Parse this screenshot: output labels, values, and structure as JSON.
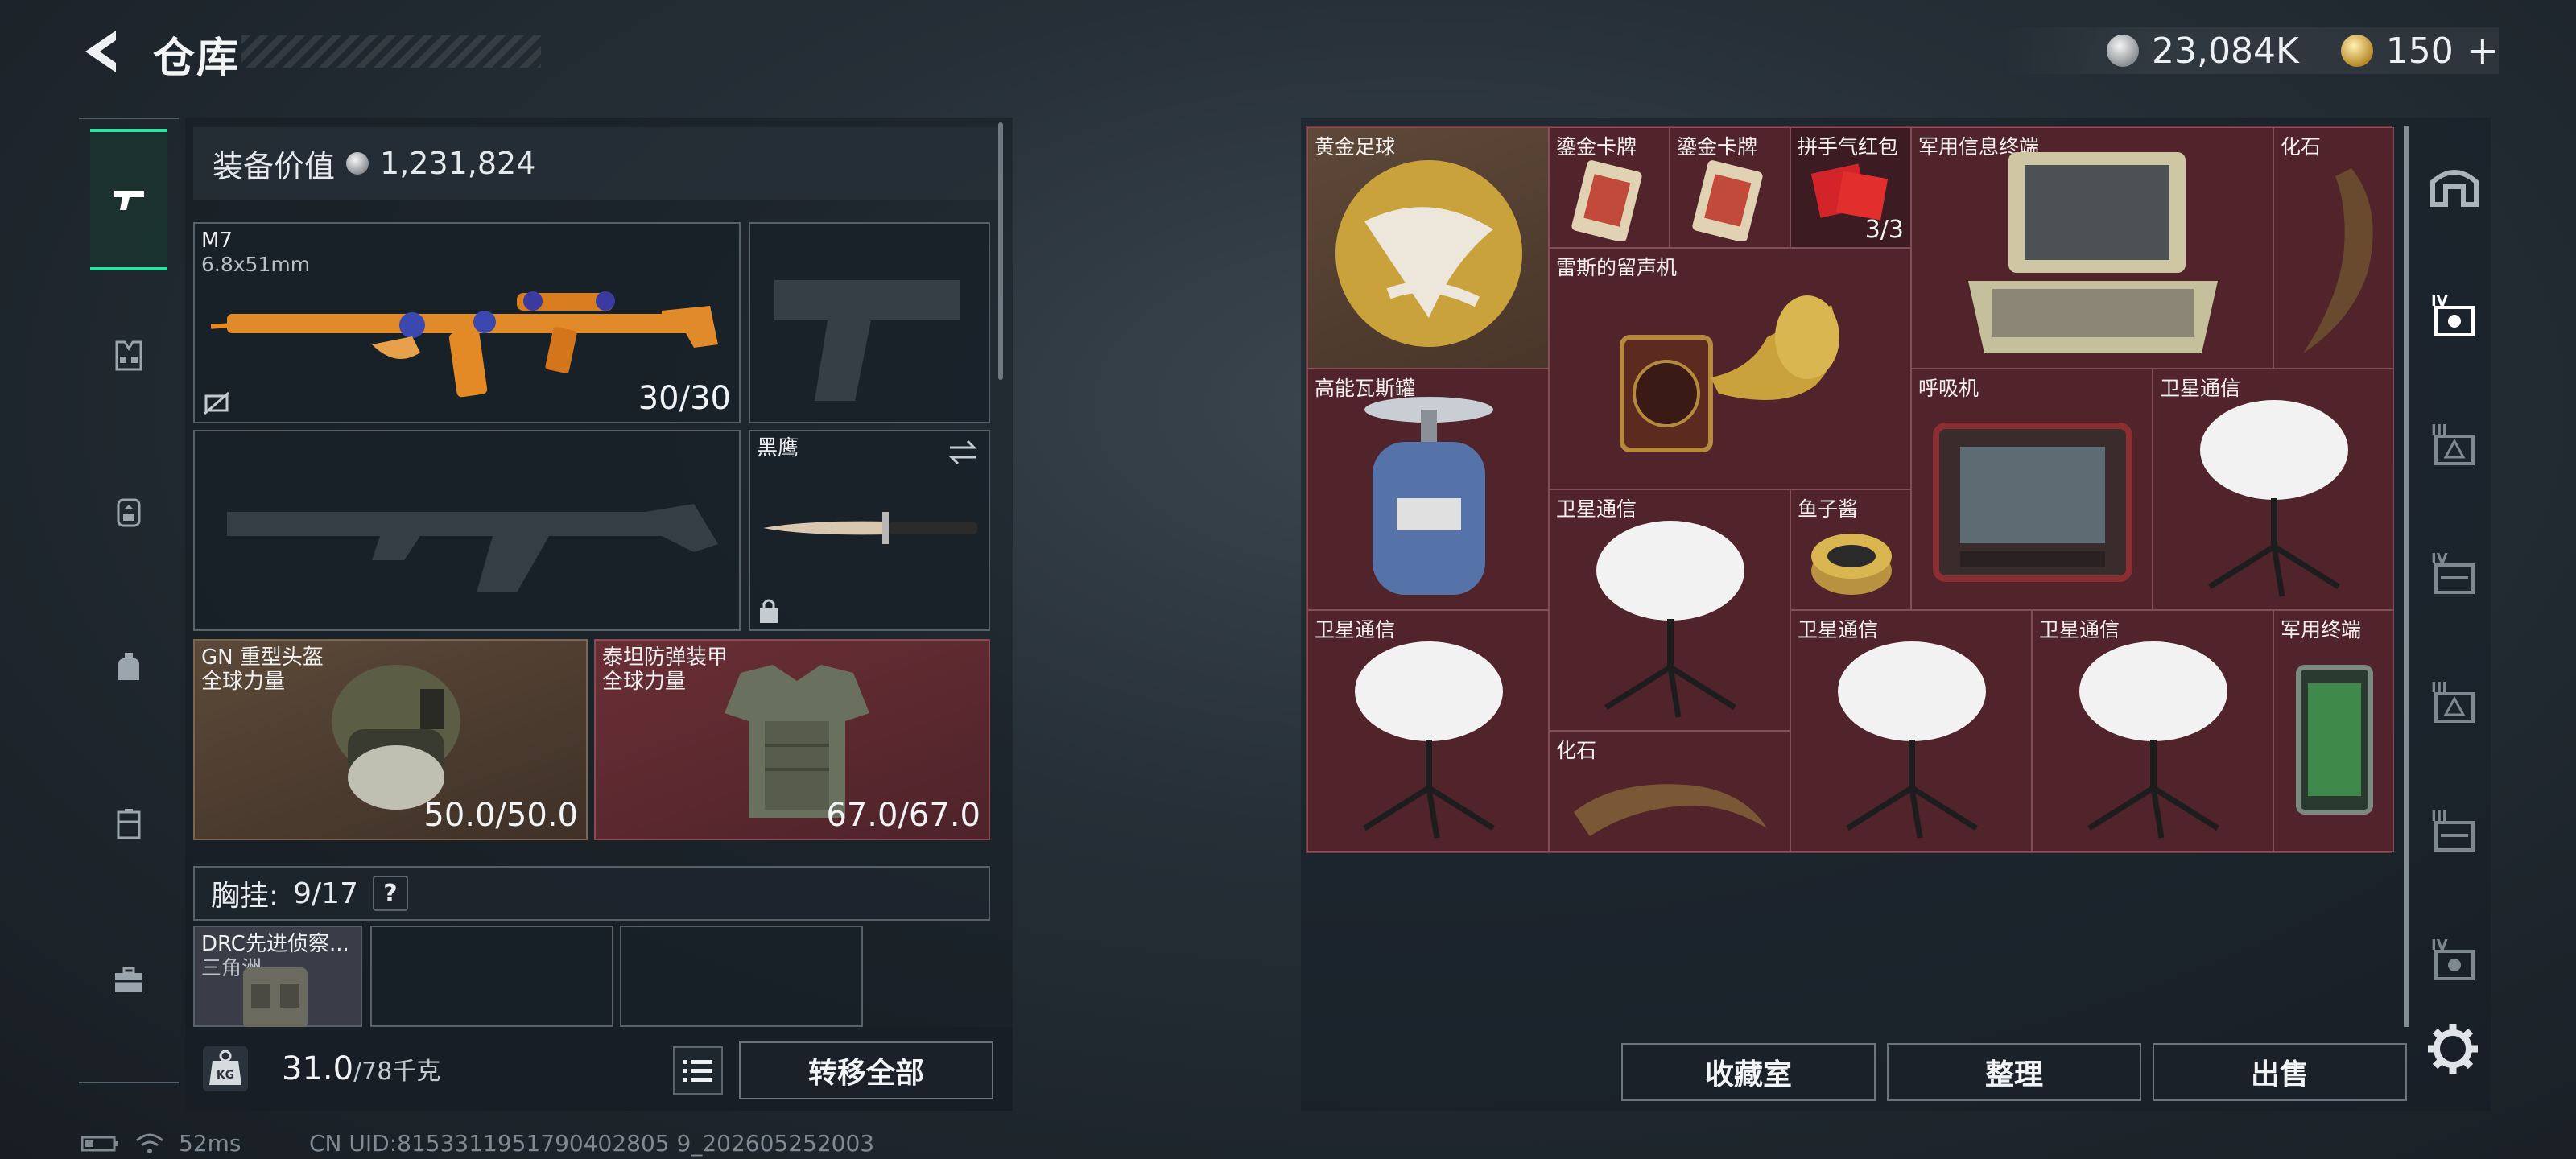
{
  "header": {
    "title": "仓库",
    "currency_amount": "23,084K",
    "premium_amount": "150",
    "premium_add": "+"
  },
  "rail": {
    "items": [
      "pistol-icon",
      "armor-rig-icon",
      "backpack-icon",
      "bag-icon",
      "case-icon",
      "toolbox-icon"
    ],
    "active_index": 0
  },
  "loadout": {
    "value_label": "装备价值",
    "value_amount": "1,231,824",
    "primary": {
      "name": "M7",
      "caliber": "6.8x51mm",
      "ammo": "30/30"
    },
    "melee": {
      "name": "黑鹰"
    },
    "helmet": {
      "name": "GN 重型头盔",
      "origin": "全球力量",
      "durability": "50.0/50.0"
    },
    "armor": {
      "name": "泰坦防弹装甲",
      "origin": "全球力量",
      "durability": "67.0/67.0"
    },
    "chest_rig": {
      "label": "胸挂:",
      "count": "9/17",
      "help": "?"
    },
    "rig_item": {
      "name": "DRC先进侦察...",
      "origin": "三角洲"
    }
  },
  "footer": {
    "weight": "31.0",
    "weight_max": "/78千克",
    "weight_icon_text": "KG",
    "transfer_all": "转移全部"
  },
  "storage": {
    "items": {
      "golden_ball": "黄金足球",
      "card1": "鎏金卡牌",
      "card2": "鎏金卡牌",
      "red_packet": "拼手气红包",
      "red_packet_count": "3/3",
      "military_terminal": "军用信息终端",
      "fossil1": "化石",
      "phonograph": "雷斯的留声机",
      "gas_tank": "高能瓦斯罐",
      "ventilator": "呼吸机",
      "sat1": "卫星通信",
      "sat2": "卫星通信",
      "caviar": "鱼子酱",
      "sat3": "卫星通信",
      "sat4": "卫星通信",
      "sat5": "卫星通信",
      "mil_terminal2": "军用终端",
      "fossil2": "化石"
    },
    "buttons": {
      "collection": "收藏室",
      "organize": "整理",
      "sell": "出售"
    },
    "right_rail": [
      "safehouse-icon",
      "tier-iv-tool-icon",
      "tier-iii-triangle-icon",
      "tier-iv-gun-icon",
      "tier-iii-triangle-icon-2",
      "tier-iii-gun-icon",
      "tier-iv-tool-icon-2"
    ]
  },
  "status": {
    "ping": "52ms",
    "uid": "CN UID:8153311951790402805 9_202605252003"
  }
}
